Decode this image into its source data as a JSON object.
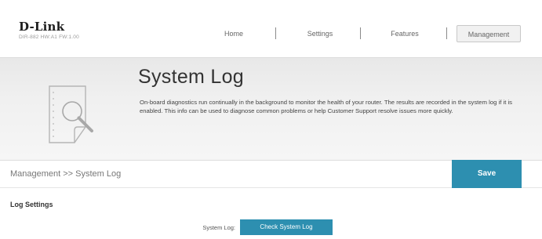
{
  "header": {
    "brand": "D-Link",
    "model": "DIR-882 HW:A1 FW:1.00",
    "nav": [
      {
        "label": "Home"
      },
      {
        "label": "Settings"
      },
      {
        "label": "Features"
      },
      {
        "label": "Management",
        "active": true
      }
    ]
  },
  "banner": {
    "icon": "magnifier-document-icon",
    "title": "System Log",
    "description": "On-board diagnostics run continually in the background to monitor the health of your router. The results are recorded in the system log if it is enabled. This info can be used to diagnose common problems or help Customer Support resolve issues more quickly."
  },
  "breadcrumb": "Management >> System Log",
  "save_label": "Save",
  "log_settings": {
    "section_title": "Log Settings",
    "system_log_label": "System Log:",
    "check_button_label": "Check System Log"
  },
  "colors": {
    "accent": "#2d8fb0",
    "banner_bg": "#eeeeee"
  }
}
